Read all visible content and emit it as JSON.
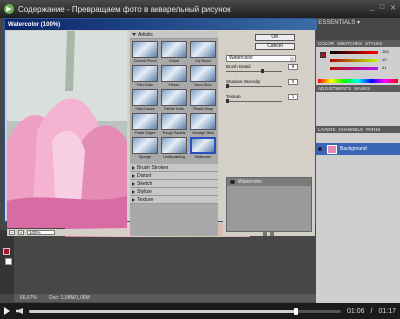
{
  "player": {
    "title": "Содержание - Превращаем фото в акварельный рисунок",
    "time_current": "01:06",
    "time_total": "01:17",
    "progress_fraction": 0.857
  },
  "photoshop": {
    "workspace": "ESSENTIALS ▾",
    "zoom_status": "66,67%",
    "doc_status": "Doc: 1,08M/1,08M",
    "panels": {
      "color_tabs": [
        "COLOR",
        "SWATCHES",
        "STYLES"
      ],
      "color_values": [
        "183",
        "12",
        "41"
      ],
      "adjust_tabs": [
        "ADJUSTMENTS",
        "MASKS"
      ],
      "layers_tabs": [
        "LAYERS",
        "CHANNELS",
        "PATHS"
      ],
      "layer_name": "Background"
    }
  },
  "filter_gallery": {
    "title": "Watercolor (100%)",
    "zoom_value": "100%",
    "artistic_folder": "Artistic",
    "filters": [
      {
        "label": "Colored Pencil",
        "selected": false
      },
      {
        "label": "Cutout",
        "selected": false
      },
      {
        "label": "Dry Brush",
        "selected": false
      },
      {
        "label": "Film Grain",
        "selected": false
      },
      {
        "label": "Fresco",
        "selected": false
      },
      {
        "label": "Neon Glow",
        "selected": false
      },
      {
        "label": "Paint Daubs",
        "selected": false
      },
      {
        "label": "Palette Knife",
        "selected": false
      },
      {
        "label": "Plastic Wrap",
        "selected": false
      },
      {
        "label": "Poster Edges",
        "selected": false
      },
      {
        "label": "Rough Pastels",
        "selected": false
      },
      {
        "label": "Smudge Stick",
        "selected": false
      },
      {
        "label": "Sponge",
        "selected": false
      },
      {
        "label": "Underpainting",
        "selected": false
      },
      {
        "label": "Watercolor",
        "selected": true
      }
    ],
    "collapsed_folders": [
      "Brush Strokes",
      "Distort",
      "Sketch",
      "Stylize",
      "Texture"
    ],
    "ok_label": "OK",
    "cancel_label": "Cancel",
    "selected_filter": "Watercolor",
    "params": [
      {
        "label": "Brush Detail",
        "value": "9",
        "fraction": 0.64
      },
      {
        "label": "Shadow Intensity",
        "value": "0",
        "fraction": 0.0
      },
      {
        "label": "Texture",
        "value": "1",
        "fraction": 0.0
      }
    ],
    "effect_layer": "Watercolor"
  }
}
